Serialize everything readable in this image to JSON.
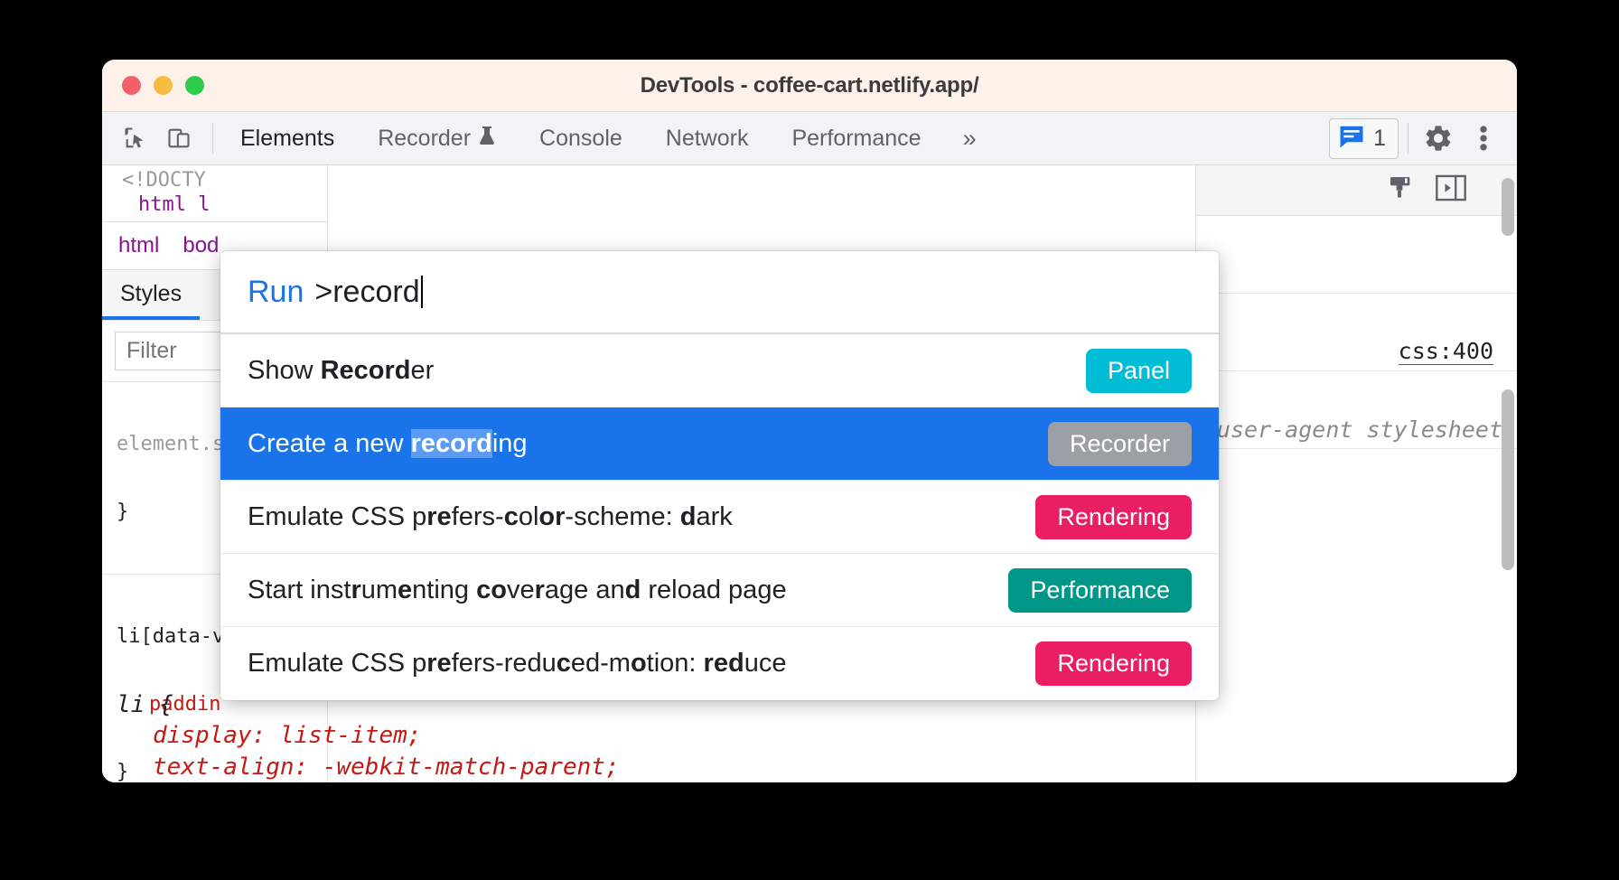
{
  "window": {
    "title": "DevTools - coffee-cart.netlify.app/",
    "traffic_lights": [
      "close-red",
      "minimize-yellow",
      "maximize-green"
    ]
  },
  "toolbar": {
    "left_icons": [
      {
        "name": "inspect-element-icon"
      },
      {
        "name": "device-toolbar-icon"
      }
    ],
    "tabs": [
      {
        "label": "Elements",
        "active": true,
        "icon": null
      },
      {
        "label": "Recorder",
        "active": false,
        "icon": "flask-icon"
      },
      {
        "label": "Console",
        "active": false,
        "icon": null
      },
      {
        "label": "Network",
        "active": false,
        "icon": null
      },
      {
        "label": "Performance",
        "active": false,
        "icon": null
      }
    ],
    "more_tabs": "»",
    "messages_count": "1",
    "settings_icon": "gear-icon",
    "more_menu_icon": "kebab-menu-icon"
  },
  "palette": {
    "prefix": "Run",
    "query": ">record",
    "rows": [
      {
        "parts": [
          {
            "t": "Show ",
            "b": false
          },
          {
            "t": "Record",
            "b": true
          },
          {
            "t": "er",
            "b": false
          }
        ],
        "badge": "Panel",
        "badge_color": "#00bcd4",
        "selected": false
      },
      {
        "parts": [
          {
            "t": "Create a new ",
            "b": false
          },
          {
            "t": "record",
            "b": true
          },
          {
            "t": "ing",
            "b": false
          }
        ],
        "badge": "Recorder",
        "badge_color": "#9aa0a6",
        "selected": true
      },
      {
        "parts": [
          {
            "t": "Emulate CSS p",
            "b": false
          },
          {
            "t": "re",
            "b": true
          },
          {
            "t": "fers-",
            "b": false
          },
          {
            "t": "c",
            "b": true
          },
          {
            "t": "ol",
            "b": false
          },
          {
            "t": "or",
            "b": true
          },
          {
            "t": "-scheme: ",
            "b": false
          },
          {
            "t": "d",
            "b": true
          },
          {
            "t": "ark",
            "b": false
          }
        ],
        "badge": "Rendering",
        "badge_color": "#e91e63",
        "selected": false
      },
      {
        "parts": [
          {
            "t": "Start inst",
            "b": false
          },
          {
            "t": "r",
            "b": true
          },
          {
            "t": "um",
            "b": false
          },
          {
            "t": "e",
            "b": true
          },
          {
            "t": "nting ",
            "b": false
          },
          {
            "t": "co",
            "b": true
          },
          {
            "t": "ve",
            "b": false
          },
          {
            "t": "r",
            "b": true
          },
          {
            "t": "age an",
            "b": false
          },
          {
            "t": "d",
            "b": true
          },
          {
            "t": " reload page",
            "b": false
          }
        ],
        "badge": "Performance",
        "badge_color": "#009688",
        "selected": false
      },
      {
        "parts": [
          {
            "t": "Emulate CSS p",
            "b": false
          },
          {
            "t": "re",
            "b": true
          },
          {
            "t": "fers-redu",
            "b": false
          },
          {
            "t": "c",
            "b": true
          },
          {
            "t": "ed-m",
            "b": false
          },
          {
            "t": "o",
            "b": true
          },
          {
            "t": "tion: ",
            "b": false
          },
          {
            "t": "red",
            "b": true
          },
          {
            "t": "uce",
            "b": false
          }
        ],
        "badge": "Rendering",
        "badge_color": "#e91e63",
        "selected": false
      }
    ]
  },
  "elements_panel": {
    "dom_line1": "<!DOCTY",
    "dom_line2_prefix": "html l",
    "breadcrumbs": [
      "html",
      "bod"
    ],
    "styles_tab": "Styles",
    "filter_placeholder": "Filter",
    "css_rules": [
      {
        "selector": "element.s",
        "prop": null,
        "close": "}"
      },
      {
        "selector": "li[data-v",
        "prop": "paddin",
        "close": "}"
      }
    ],
    "bottom_rule": {
      "selector": "li {",
      "declarations": [
        "display: list-item;",
        "text-align: -webkit-match-parent;"
      ]
    }
  },
  "right_panel": {
    "icons": [
      {
        "name": "paintbrush-icon"
      },
      {
        "name": "toggle-sidebar-icon"
      }
    ],
    "source_link": "css:400",
    "user_agent_stylesheet": "user-agent stylesheet"
  }
}
